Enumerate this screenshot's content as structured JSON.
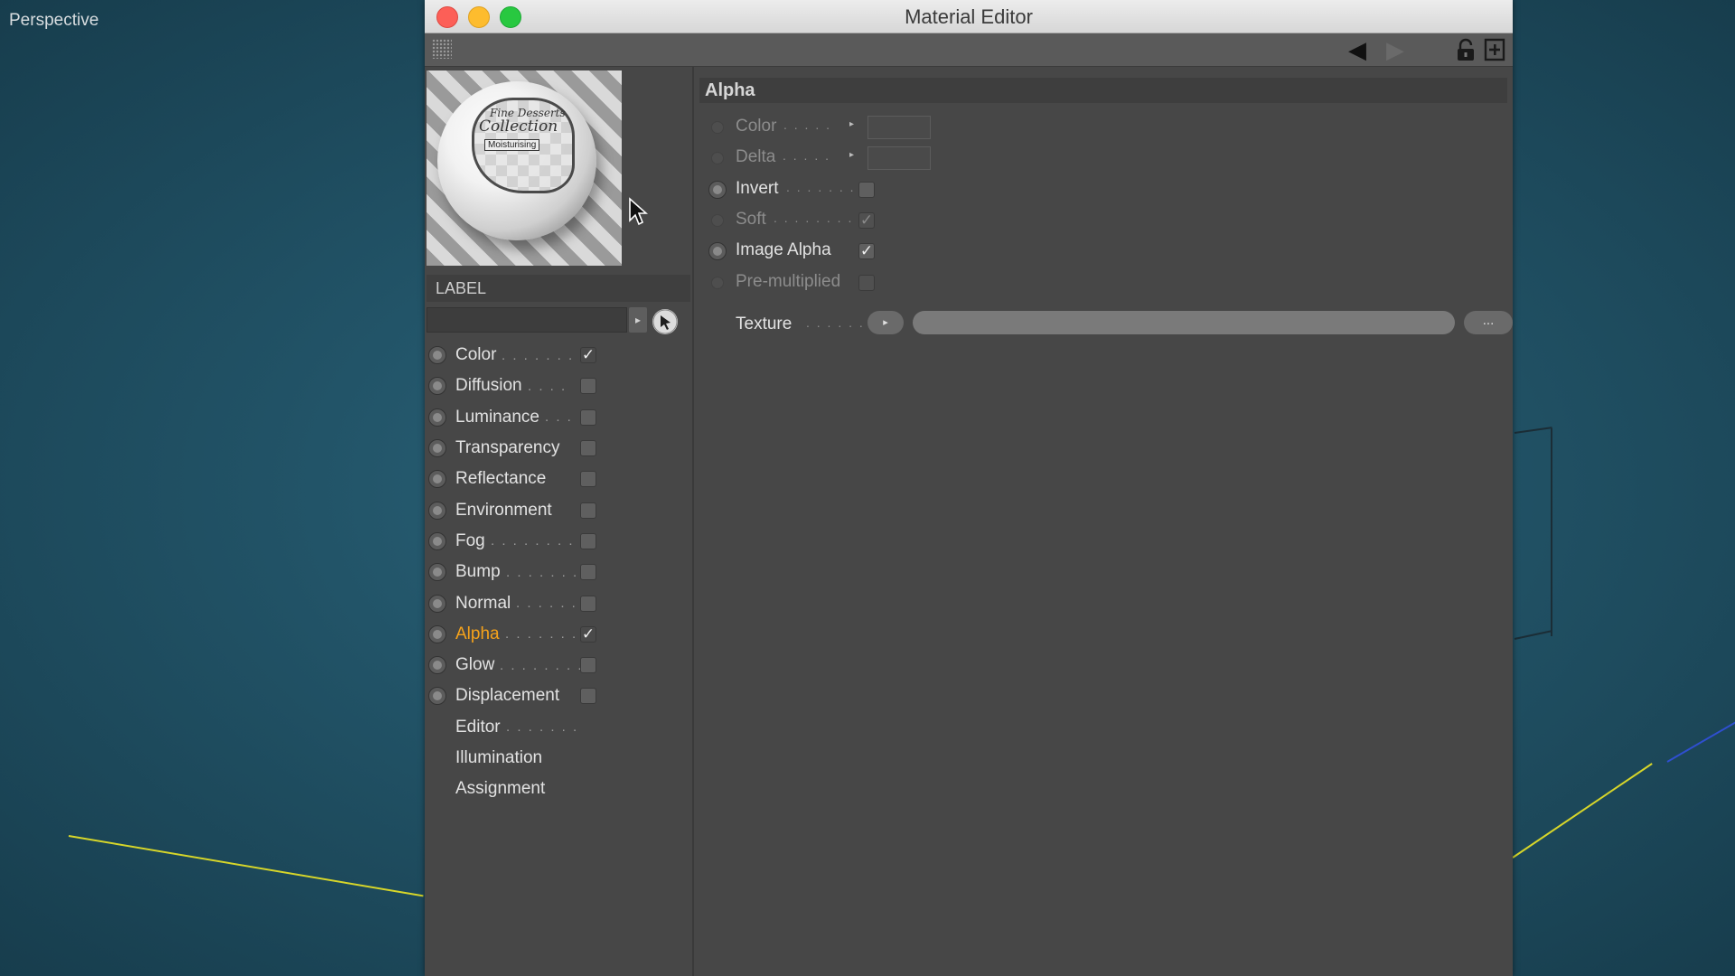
{
  "viewport": {
    "label": "Perspective"
  },
  "window": {
    "title": "Material Editor"
  },
  "toolbar": {
    "back_icon": "arrow-left-icon",
    "forward_icon": "arrow-right-icon",
    "lock_icon": "lock-icon",
    "new_icon": "new-window-icon"
  },
  "preview": {
    "line1": "Fine Desserts",
    "line2": "Collection",
    "line3": "Moisturising"
  },
  "label_section": {
    "header": "LABEL",
    "field_value": ""
  },
  "channels": [
    {
      "label": "Color",
      "dots": ". . . . . . .",
      "checked": true,
      "active": false,
      "radio": true
    },
    {
      "label": "Diffusion",
      "dots": ". . . .",
      "checked": false,
      "active": false,
      "radio": true
    },
    {
      "label": "Luminance",
      "dots": ". . .",
      "checked": false,
      "active": false,
      "radio": true
    },
    {
      "label": "Transparency",
      "dots": "",
      "checked": false,
      "active": false,
      "radio": true
    },
    {
      "label": "Reflectance",
      "dots": "",
      "checked": false,
      "active": false,
      "radio": true
    },
    {
      "label": "Environment",
      "dots": "",
      "checked": false,
      "active": false,
      "radio": true
    },
    {
      "label": "Fog",
      "dots": ". . . . . . . . .",
      "checked": false,
      "active": false,
      "radio": true
    },
    {
      "label": "Bump",
      "dots": ". . . . . . .",
      "checked": false,
      "active": false,
      "radio": true
    },
    {
      "label": "Normal",
      "dots": ". . . . . .",
      "checked": false,
      "active": false,
      "radio": true
    },
    {
      "label": "Alpha",
      "dots": ". . . . . . .",
      "checked": true,
      "active": true,
      "radio": true
    },
    {
      "label": "Glow",
      "dots": ". . . . . . . .",
      "checked": false,
      "active": false,
      "radio": true
    },
    {
      "label": "Displacement",
      "dots": "",
      "checked": false,
      "active": false,
      "radio": true
    },
    {
      "label": "Editor",
      "dots": ". . . . . . .",
      "checked": null,
      "active": false,
      "radio": false
    },
    {
      "label": "Illumination",
      "dots": "",
      "checked": null,
      "active": false,
      "radio": false
    },
    {
      "label": "Assignment",
      "dots": "",
      "checked": null,
      "active": false,
      "radio": false
    }
  ],
  "alpha_panel": {
    "header": "Alpha",
    "props": [
      {
        "label": "Color",
        "dots": ". . . . .",
        "kind": "swatch",
        "enabled": false
      },
      {
        "label": "Delta",
        "dots": ". . . . .",
        "kind": "swatch",
        "enabled": false
      },
      {
        "label": "Invert",
        "dots": ". . . . . . .",
        "kind": "checkbox",
        "checked": false,
        "enabled": true
      },
      {
        "label": "Soft",
        "dots": ". . . . . . . .",
        "kind": "checkbox",
        "checked": true,
        "enabled": false
      },
      {
        "label": "Image Alpha",
        "dots": "",
        "kind": "checkbox",
        "checked": true,
        "enabled": true
      },
      {
        "label": "Pre-multiplied",
        "dots": "",
        "kind": "checkbox",
        "checked": false,
        "enabled": false
      }
    ],
    "texture": {
      "label": "Texture",
      "dots": ". . . . . .",
      "play": "▸",
      "more": "..."
    }
  },
  "colors": {
    "accent": "#f5a21b",
    "panel": "#474747",
    "header": "#3e3e3e"
  }
}
